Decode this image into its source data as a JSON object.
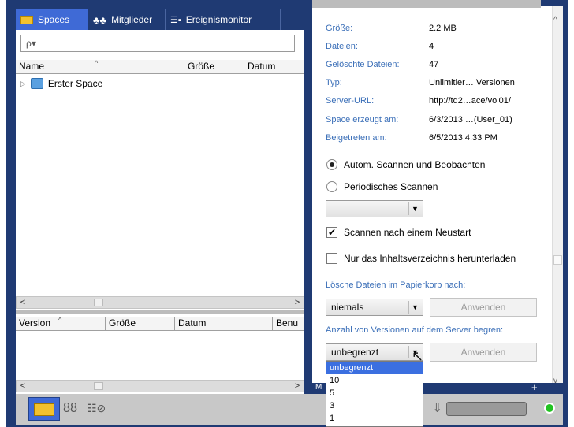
{
  "tabs": [
    {
      "label": "Spaces",
      "icon": "folder-icon"
    },
    {
      "label": "Mitglieder",
      "icon": "members-icon"
    },
    {
      "label": "Ereignismonitor",
      "icon": "event-monitor-icon"
    }
  ],
  "search": {
    "placeholder": "",
    "glyph": "ρ▾"
  },
  "tree_columns": [
    "Name",
    "Größe",
    "Datum"
  ],
  "tree_rows": [
    {
      "label": "Erster Space"
    }
  ],
  "version_columns": [
    "Version",
    "Größe",
    "Datum",
    "Benu"
  ],
  "details": [
    {
      "label": "Größe:",
      "value": "2.2 MB"
    },
    {
      "label": "Dateien:",
      "value": "4"
    },
    {
      "label": "Gelöschte Dateien:",
      "value": "47"
    },
    {
      "label": "Typ:",
      "value": "Unlimitier… Versionen"
    },
    {
      "label": "Server-URL:",
      "value": "http://td2…ace/vol01/"
    },
    {
      "label": "Space erzeugt am:",
      "value": "6/3/2013 …(User_01)"
    },
    {
      "label": "Beigetreten am:",
      "value": "6/5/2013 4:33 PM"
    }
  ],
  "scan": {
    "option1": "Autom. Scannen und Beobachten",
    "option2": "Periodisches Scannen",
    "restart_label": "Scannen nach einem Neustart",
    "toc_label": "Nur das Inhaltsverzeichnis herunterladen",
    "restart_checked": true,
    "toc_checked": false
  },
  "trash": {
    "title": "Lösche Dateien im Papierkorb nach:",
    "value": "niemals",
    "apply": "Anwenden"
  },
  "versions": {
    "title": "Anzahl von Versionen auf dem Server begren:",
    "value": "unbegrenzt",
    "apply": "Anwenden",
    "options": [
      "unbegrenzt",
      "10",
      "5",
      "3",
      "1"
    ]
  },
  "colors": {
    "frame": "#1f3a73",
    "accent": "#3f6ad6",
    "label_blue": "#3b6fb8",
    "status_green": "#22c322"
  }
}
